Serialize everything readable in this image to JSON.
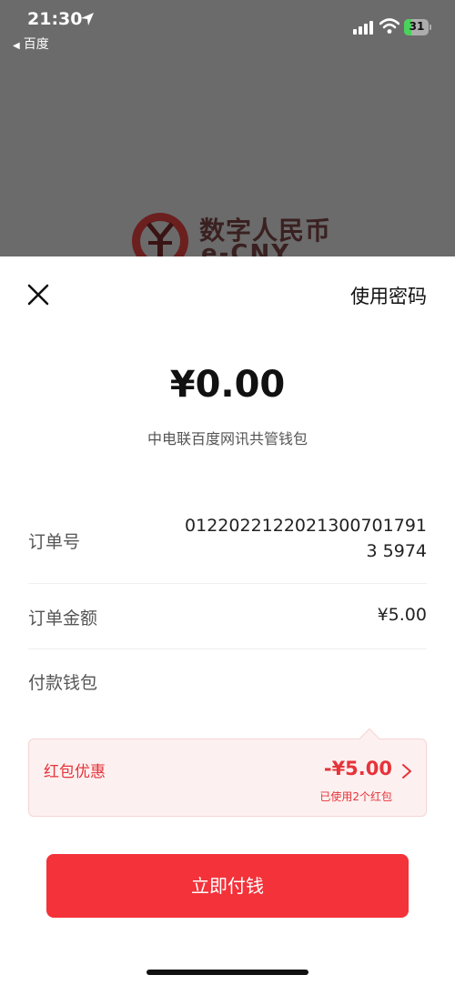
{
  "status_bar": {
    "time": "21:30",
    "back_app": "百度",
    "battery": "31",
    "battery_level_percent": 31,
    "icons": [
      "location-arrow-icon",
      "signal-icon",
      "wifi-icon",
      "battery-icon"
    ]
  },
  "logo": {
    "cn": "数字人民币",
    "en": "e-CNY"
  },
  "sheet": {
    "use_password": "使用密码",
    "amount": "¥0.00",
    "merchant": "中电联百度网讯共管钱包",
    "order_number_label": "订单号",
    "order_number_value": "01220221220213007017913 5974",
    "order_amount_label": "订单金额",
    "order_amount_value": "¥5.00",
    "wallet_label": "付款钱包",
    "redpacket_label": "红包优惠",
    "redpacket_value": "-¥5.00",
    "redpacket_sub": "已使用2个红包",
    "pay_button": "立即付钱"
  },
  "colors": {
    "accent_red": "#f3323a",
    "redpacket_bg": "#fdf0f0",
    "overlay": "#6b6b6b"
  }
}
